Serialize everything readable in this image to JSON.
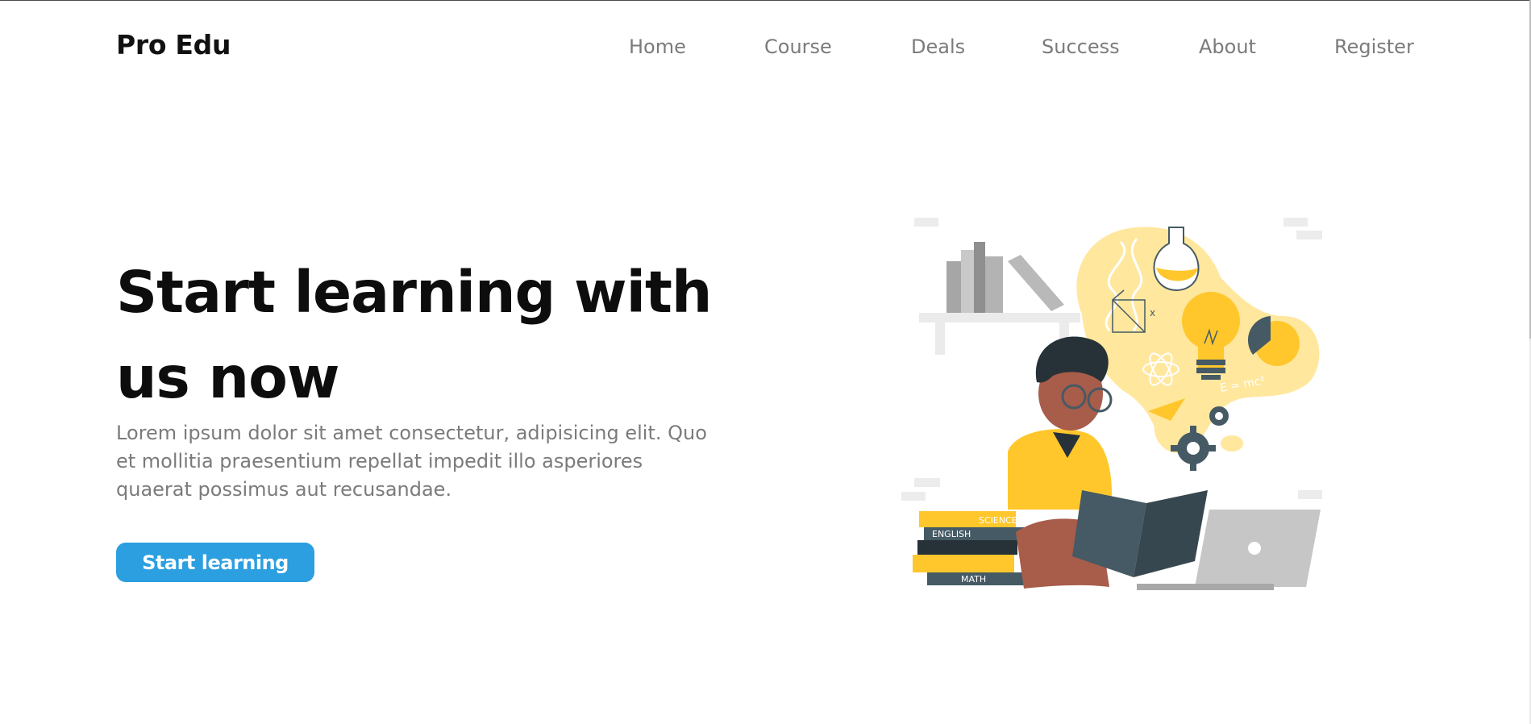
{
  "brand": {
    "name": "Pro Edu"
  },
  "nav": {
    "items": [
      {
        "label": "Home"
      },
      {
        "label": "Course"
      },
      {
        "label": "Deals"
      },
      {
        "label": "Success"
      },
      {
        "label": "About"
      },
      {
        "label": "Register"
      }
    ]
  },
  "hero": {
    "title_line1": "Start learning with",
    "title_line2": "us now",
    "description": "Lorem ipsum dolor sit amet consectetur, adipisicing elit. Quo et mollitia praesentium repellat impedit illo asperiores quaerat possimus aut recusandae.",
    "cta_label": "Start learning"
  },
  "illustration": {
    "book_labels": [
      "SCIENCE",
      "ENGLISH",
      "MATH"
    ],
    "formula": "E = mc²",
    "variable": "x"
  },
  "colors": {
    "accent": "#2b9fe0",
    "illustration_yellow": "#ffc72c",
    "illustration_pale_yellow": "#ffe79e",
    "illustration_dark": "#455a64",
    "skin": "#a85c4a"
  }
}
